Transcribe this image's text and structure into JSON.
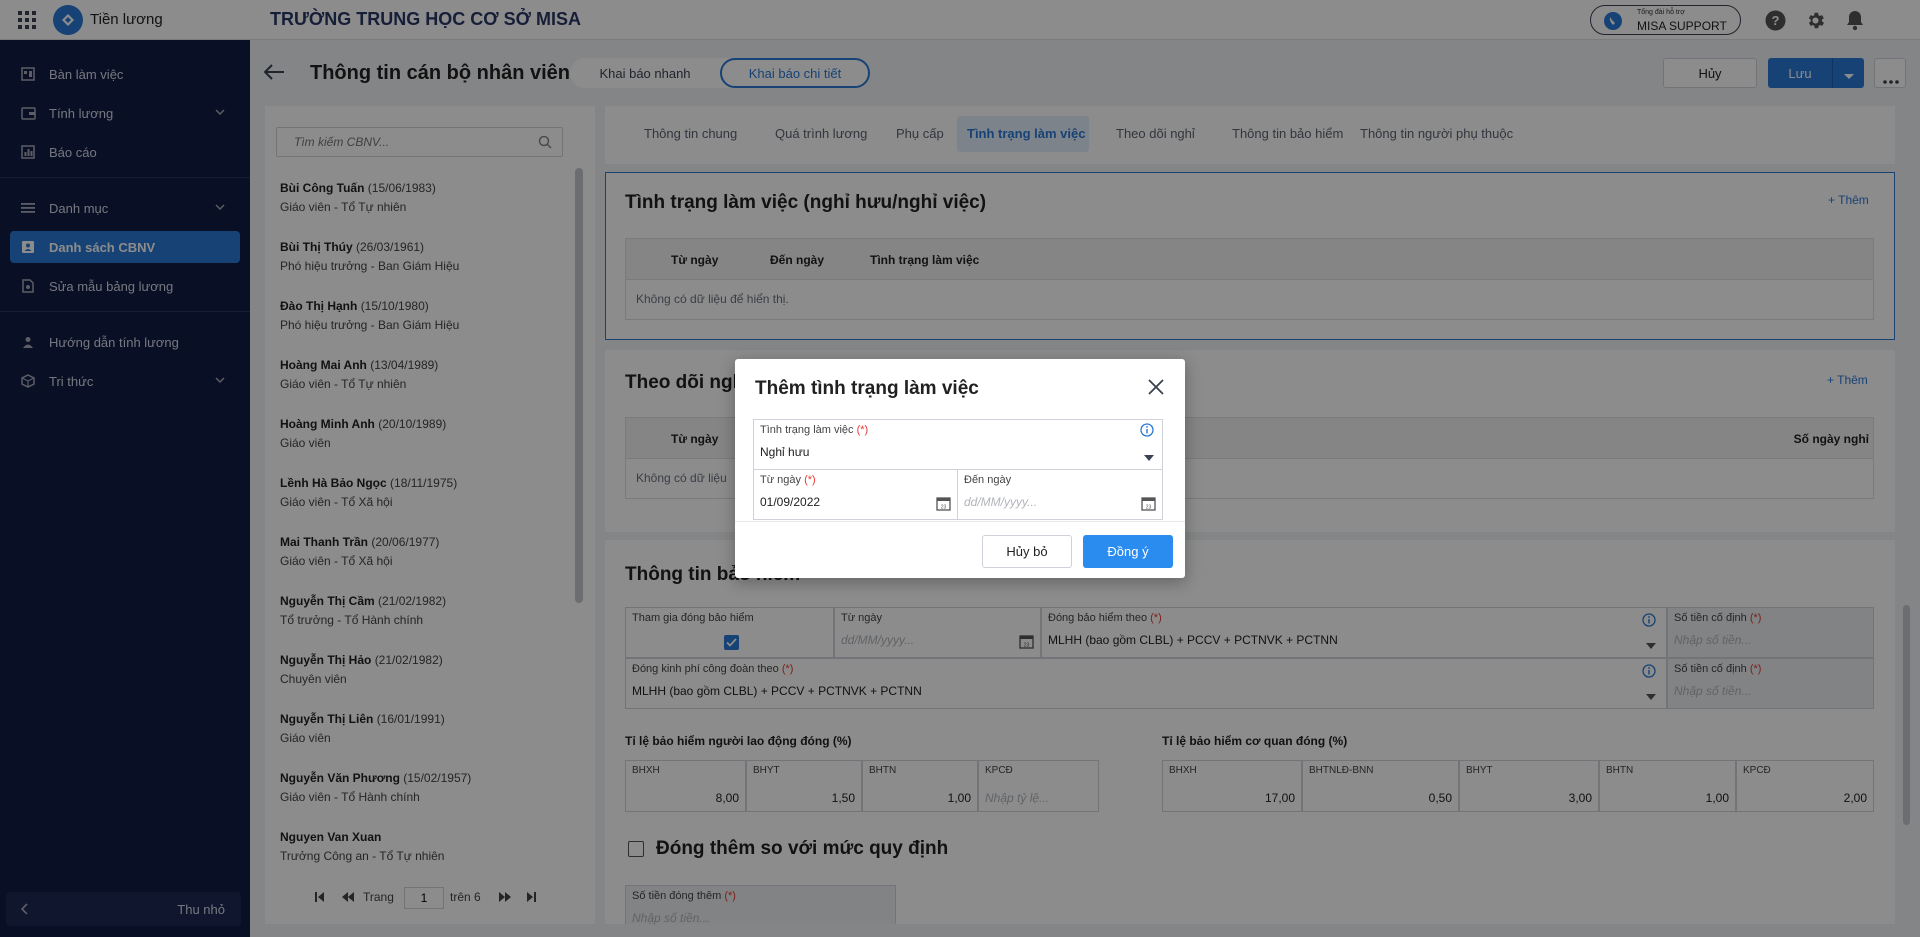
{
  "topbar": {
    "app_name": "Tiền lương",
    "school_name": "TRƯỜNG TRUNG HỌC CƠ SỞ MISA",
    "support_small": "Tổng đài hỗ trợ",
    "support_label": "MISA SUPPORT",
    "icons": [
      "apps-grid-icon",
      "help-icon",
      "gear-icon",
      "bell-icon"
    ]
  },
  "sidebar": {
    "items": [
      {
        "label": "Bàn làm việc",
        "icon": "dashboard-icon"
      },
      {
        "label": "Tính lương",
        "icon": "wallet-icon"
      },
      {
        "label": "Báo cáo",
        "icon": "report-icon"
      },
      {
        "label": "Danh mục",
        "icon": "category-icon"
      },
      {
        "label": "Danh sách CBNV",
        "icon": "staff-list-icon"
      },
      {
        "label": "Sửa mẫu bảng lương",
        "icon": "edit-template-icon"
      },
      {
        "label": "Hướng dẫn tính lương",
        "icon": "guide-icon"
      },
      {
        "label": "Tri thức",
        "icon": "knowledge-icon"
      }
    ],
    "collapse_label": "Thu nhỏ",
    "active_color": "#2b78d5"
  },
  "header": {
    "title": "Thông tin cán bộ nhân viên",
    "toggle": [
      "Khai báo nhanh",
      "Khai báo chi tiết"
    ],
    "cancel_label": "Hủy",
    "save_label": "Lưu"
  },
  "employee_list": {
    "search_placeholder": "Tìm kiếm CBNV...",
    "employees": [
      {
        "name": "Bùi Công Tuấn",
        "dob": "(15/06/1983)",
        "role": "Giáo viên - Tổ Tự nhiên"
      },
      {
        "name": "Bùi Thị Thúy",
        "dob": "(26/03/1961)",
        "role": "Phó hiệu trưởng - Ban Giám Hiệu"
      },
      {
        "name": "Đào Thị Hạnh",
        "dob": "(15/10/1980)",
        "role": "Phó hiệu trưởng - Ban Giám Hiệu"
      },
      {
        "name": "Hoàng Mai Anh",
        "dob": "(13/04/1989)",
        "role": "Giáo viên - Tổ Tự nhiên"
      },
      {
        "name": "Hoàng Minh Anh",
        "dob": "(20/10/1989)",
        "role": "Giáo viên"
      },
      {
        "name": "Lềnh Hà Bảo Ngọc",
        "dob": "(18/11/1975)",
        "role": "Giáo viên - Tổ Xã hội"
      },
      {
        "name": "Mai Thanh Trần",
        "dob": "(20/06/1977)",
        "role": "Giáo viên - Tổ Xã hội"
      },
      {
        "name": "Nguyễn Thị Cầm",
        "dob": "(21/02/1982)",
        "role": "Tổ trưởng - Tổ Hành chính"
      },
      {
        "name": "Nguyễn Thị Hảo",
        "dob": "(21/02/1982)",
        "role": "Chuyên viên"
      },
      {
        "name": "Nguyễn Thị Liên",
        "dob": "(16/01/1991)",
        "role": "Giáo viên"
      },
      {
        "name": "Nguyễn Văn Phương",
        "dob": "(15/02/1957)",
        "role": "Giáo viên - Tổ Hành chính"
      },
      {
        "name": "Nguyen Van Xuan",
        "dob": "",
        "role": "Trưởng Công an - Tổ Tự nhiên"
      }
    ],
    "pager": {
      "page_label": "Trang",
      "page_value": "1",
      "of_label": "trên 6"
    }
  },
  "tabs": [
    "Thông tin chung",
    "Quá trình lương",
    "Phụ cấp",
    "Tình trạng làm việc",
    "Theo dõi nghỉ",
    "Thông tin bảo hiểm",
    "Thông tin người phụ thuộc"
  ],
  "work_status": {
    "title": "Tình trạng làm việc (nghỉ hưu/nghỉ việc)",
    "add_label": "+ Thêm",
    "columns": [
      "Từ ngày",
      "Đến ngày",
      "Tình trạng làm việc"
    ],
    "empty": "Không có dữ liệu để hiển thị."
  },
  "leave_tracking": {
    "title_partial": "Theo dõi ngh",
    "add_label": "+ Thêm",
    "col_from": "Từ ngày",
    "col_days": "Số ngày nghỉ",
    "empty_partial": "Không có dữ liệu"
  },
  "insurance": {
    "title_partial": "Thông tin bảo hiểm",
    "join_label": "Tham gia đóng bảo hiểm",
    "from_label": "Từ ngày",
    "from_placeholder": "dd/MM/yyyy...",
    "basis_label": "Đóng bảo hiểm theo",
    "basis_value": "MLHH (bao gồm CLBL) + PCCV + PCTNVK + PCTNN",
    "fixed_label": "Số tiền cố định",
    "fixed_placeholder": "Nhập số tiền...",
    "union_label": "Đóng kinh phí công đoàn theo",
    "union_value": "MLHH (bao gồm CLBL) + PCCV + PCTNVK + PCTNN",
    "fixed2_label": "Số tiền cố định",
    "fixed2_placeholder": "Nhập số tiền...",
    "employee_rate_title": "Tỉ lệ bảo hiểm người lao động đóng (%)",
    "employee_rates": [
      {
        "label": "BHXH",
        "value": "8,00"
      },
      {
        "label": "BHYT",
        "value": "1,50"
      },
      {
        "label": "BHTN",
        "value": "1,00"
      },
      {
        "label": "KPCĐ",
        "value": "",
        "placeholder": "Nhập tỷ lệ..."
      }
    ],
    "employer_rate_title": "Tỉ lệ bảo hiểm cơ quan đóng (%)",
    "employer_rates": [
      {
        "label": "BHXH",
        "value": "17,00"
      },
      {
        "label": "BHTNLĐ-BNN",
        "value": "0,50"
      },
      {
        "label": "BHYT",
        "value": "3,00"
      },
      {
        "label": "BHTN",
        "value": "1,00"
      },
      {
        "label": "KPCĐ",
        "value": "2,00"
      }
    ],
    "extra_label": "Đóng thêm so với mức quy định",
    "extra_amount_label": "Số tiền đóng thêm",
    "extra_amount_placeholder": "Nhập số tiền..."
  },
  "dialog": {
    "title": "Thêm tình trạng làm việc",
    "status_label": "Tình trạng làm việc",
    "status_value": "Nghỉ hưu",
    "from_label": "Từ ngày",
    "from_value": "01/09/2022",
    "to_label": "Đến ngày",
    "to_placeholder": "dd/MM/yyyy...",
    "required_mark": "(*)",
    "cancel_label": "Hủy bỏ",
    "ok_label": "Đồng ý"
  }
}
